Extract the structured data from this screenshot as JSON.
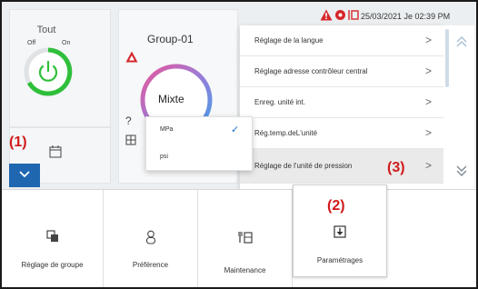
{
  "status": {
    "datetime": "25/03/2021 Je 02:39 PM",
    "icons": [
      "warning-icon",
      "maintenance-status-icon",
      "settings-status-icon"
    ]
  },
  "tout": {
    "title": "Tout",
    "off_label": "Off",
    "on_label": "On",
    "power_state": "on"
  },
  "group": {
    "name": "Group-01",
    "mode": "Mixte",
    "alert": true,
    "help_glyph": "?"
  },
  "settings_menu": {
    "items": [
      {
        "label": "Réglage de la langue",
        "chevron": ">"
      },
      {
        "label": "Réglage adresse contrôleur central",
        "chevron": ">"
      },
      {
        "label": "Enreg. unité int.",
        "chevron": ">"
      },
      {
        "label": "Rég.temp.deL'unité",
        "chevron": ">"
      },
      {
        "label": "Réglage de l'unité de pression",
        "chevron": ">",
        "active": true
      }
    ]
  },
  "pressure_menu": {
    "options": [
      {
        "label": "MPa",
        "selected": true,
        "check": "✓"
      },
      {
        "label": "psi",
        "selected": false
      }
    ]
  },
  "bottom_nav": {
    "items": [
      {
        "label": "Réglage de groupe",
        "icon": "group-settings-icon"
      },
      {
        "label": "Préférence",
        "icon": "preference-icon"
      },
      {
        "label": "Maintenance",
        "icon": "maintenance-icon"
      },
      {
        "label": "Paramétrages",
        "icon": "settings-icon",
        "selected": true
      }
    ]
  },
  "callouts": {
    "one": "(1)",
    "two": "(2)",
    "three": "(3)"
  },
  "colors": {
    "accent_blue": "#1f67b1",
    "power_green": "#2fbf3a",
    "alert_red": "#d6262b",
    "callout_red": "#d11b1b",
    "check_blue": "#1e6fc8"
  }
}
